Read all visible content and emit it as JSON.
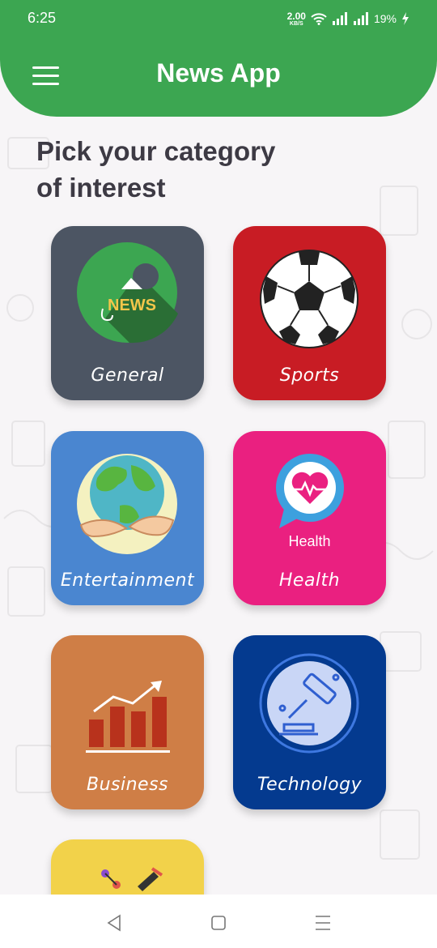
{
  "status_bar": {
    "time": "6:25",
    "net_speed_value": "2.00",
    "net_speed_unit": "KB/S",
    "battery": "19%"
  },
  "header": {
    "title": "News App",
    "menu_icon": "hamburger-menu-icon",
    "color": "#3ca651"
  },
  "page": {
    "title_line1": "Pick your category",
    "title_line2": "of interest"
  },
  "categories": [
    {
      "label": "General",
      "color": "#4c5563",
      "icon": "news-icon"
    },
    {
      "label": "Sports",
      "color": "#c81c24",
      "icon": "soccer-ball-icon"
    },
    {
      "label": "Entertainment",
      "color": "#4a86d0",
      "icon": "globe-in-hands-icon"
    },
    {
      "label": "Health",
      "color": "#ea2080",
      "icon": "heart-chat-icon",
      "icon_caption": "Health"
    },
    {
      "label": "Business",
      "color": "#cf7e46",
      "icon": "bar-chart-growth-icon"
    },
    {
      "label": "Technology",
      "color": "#043a8f",
      "icon": "gavel-icon"
    },
    {
      "label": "",
      "color": "#f2d24a",
      "icon": "science-icon"
    }
  ],
  "nav": {
    "back": "back-icon",
    "home": "home-icon",
    "recents": "recents-icon"
  }
}
